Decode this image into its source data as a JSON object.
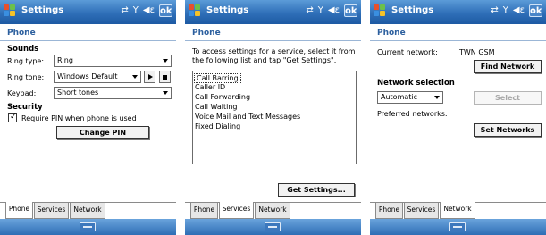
{
  "screens": [
    {
      "app_title": "Settings",
      "ok_label": "ok",
      "page_title": "Phone",
      "sounds_heading": "Sounds",
      "ring_type_label": "Ring type:",
      "ring_type_value": "Ring",
      "ring_tone_label": "Ring tone:",
      "ring_tone_value": "Windows Default",
      "keypad_label": "Keypad:",
      "keypad_value": "Short tones",
      "security_heading": "Security",
      "require_pin_label": "Require PIN when phone is used",
      "require_pin_checked": true,
      "change_pin_label": "Change PIN",
      "tabs": [
        "Phone",
        "Services",
        "Network"
      ],
      "active_tab": "Phone"
    },
    {
      "app_title": "Settings",
      "ok_label": "ok",
      "page_title": "Phone",
      "instructions": [
        "To access settings for a service, select it from",
        "the following list and tap \"Get Settings\"."
      ],
      "services": [
        "Call Barring",
        "Caller ID",
        "Call Forwarding",
        "Call Waiting",
        "Voice Mail and Text Messages",
        "Fixed Dialing"
      ],
      "selected_service": "Call Barring",
      "get_settings_label": "Get Settings...",
      "tabs": [
        "Phone",
        "Services",
        "Network"
      ],
      "active_tab": "Services"
    },
    {
      "app_title": "Settings",
      "ok_label": "ok",
      "page_title": "Phone",
      "current_network_label": "Current network:",
      "current_network_value": "TWN GSM",
      "find_network_label": "Find Network",
      "network_selection_heading": "Network selection",
      "network_selection_value": "Automatic",
      "select_label": "Select",
      "preferred_networks_label": "Preferred networks:",
      "set_networks_label": "Set Networks",
      "tabs": [
        "Phone",
        "Services",
        "Network"
      ],
      "active_tab": "Network"
    }
  ],
  "colors": {
    "titlebar": "#2f6fb8",
    "page_title": "#2c5f9e"
  },
  "icons": [
    "windows-start-icon",
    "connectivity-icon",
    "signal-icon",
    "speaker-icon",
    "keyboard-icon"
  ]
}
